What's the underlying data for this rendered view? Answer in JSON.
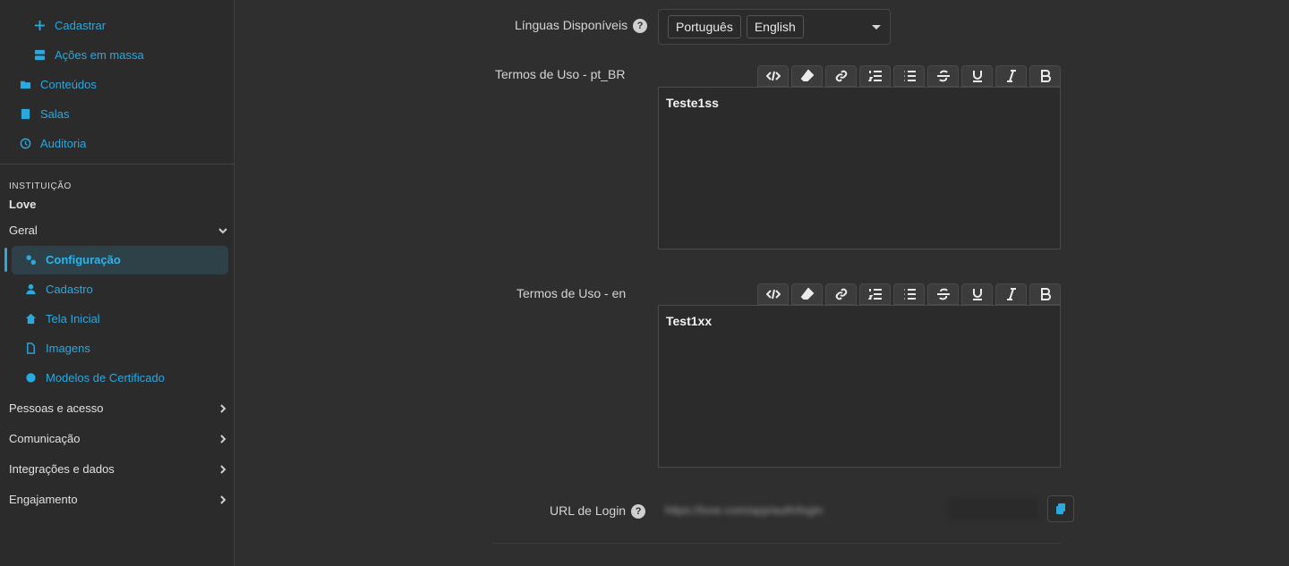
{
  "sidebar": {
    "top_items": [
      {
        "label": "Cadastrar",
        "icon": "plus-icon"
      },
      {
        "label": "Ações em massa",
        "icon": "stack-icon"
      },
      {
        "label": "Conteúdos",
        "icon": "folder-icon"
      },
      {
        "label": "Salas",
        "icon": "book-icon"
      },
      {
        "label": "Auditoria",
        "icon": "history-icon"
      }
    ],
    "section_caption": "INSTITUIÇÃO",
    "institution_name": "Love",
    "group_geral": "Geral",
    "geral_items": [
      {
        "label": "Configuração",
        "icon": "gears-icon",
        "active": true
      },
      {
        "label": "Cadastro",
        "icon": "user-icon"
      },
      {
        "label": "Tela Inicial",
        "icon": "home-icon"
      },
      {
        "label": "Imagens",
        "icon": "file-icon"
      },
      {
        "label": "Modelos de Certificado",
        "icon": "certificate-icon"
      }
    ],
    "groups": [
      "Pessoas e acesso",
      "Comunicação",
      "Integrações e dados",
      "Engajamento"
    ]
  },
  "form": {
    "languages_label": "Línguas Disponíveis",
    "languages_selected": [
      "Português",
      "English"
    ],
    "terms_pt_label": "Termos de Uso - pt_BR",
    "terms_pt_value": "Teste1ss",
    "terms_en_label": "Termos de Uso - en",
    "terms_en_value": "Test1xx",
    "login_url_label": "URL de Login",
    "login_url_value": "https://love.com/app/auth/login"
  },
  "toolbar_buttons": [
    "code-view",
    "clear-format",
    "link",
    "ordered-list",
    "unordered-list",
    "strikethrough",
    "underline",
    "italic",
    "bold"
  ],
  "colors": {
    "accent": "#2aa8e0",
    "background": "#2f2f2f",
    "active_bg": "#2e4148"
  }
}
